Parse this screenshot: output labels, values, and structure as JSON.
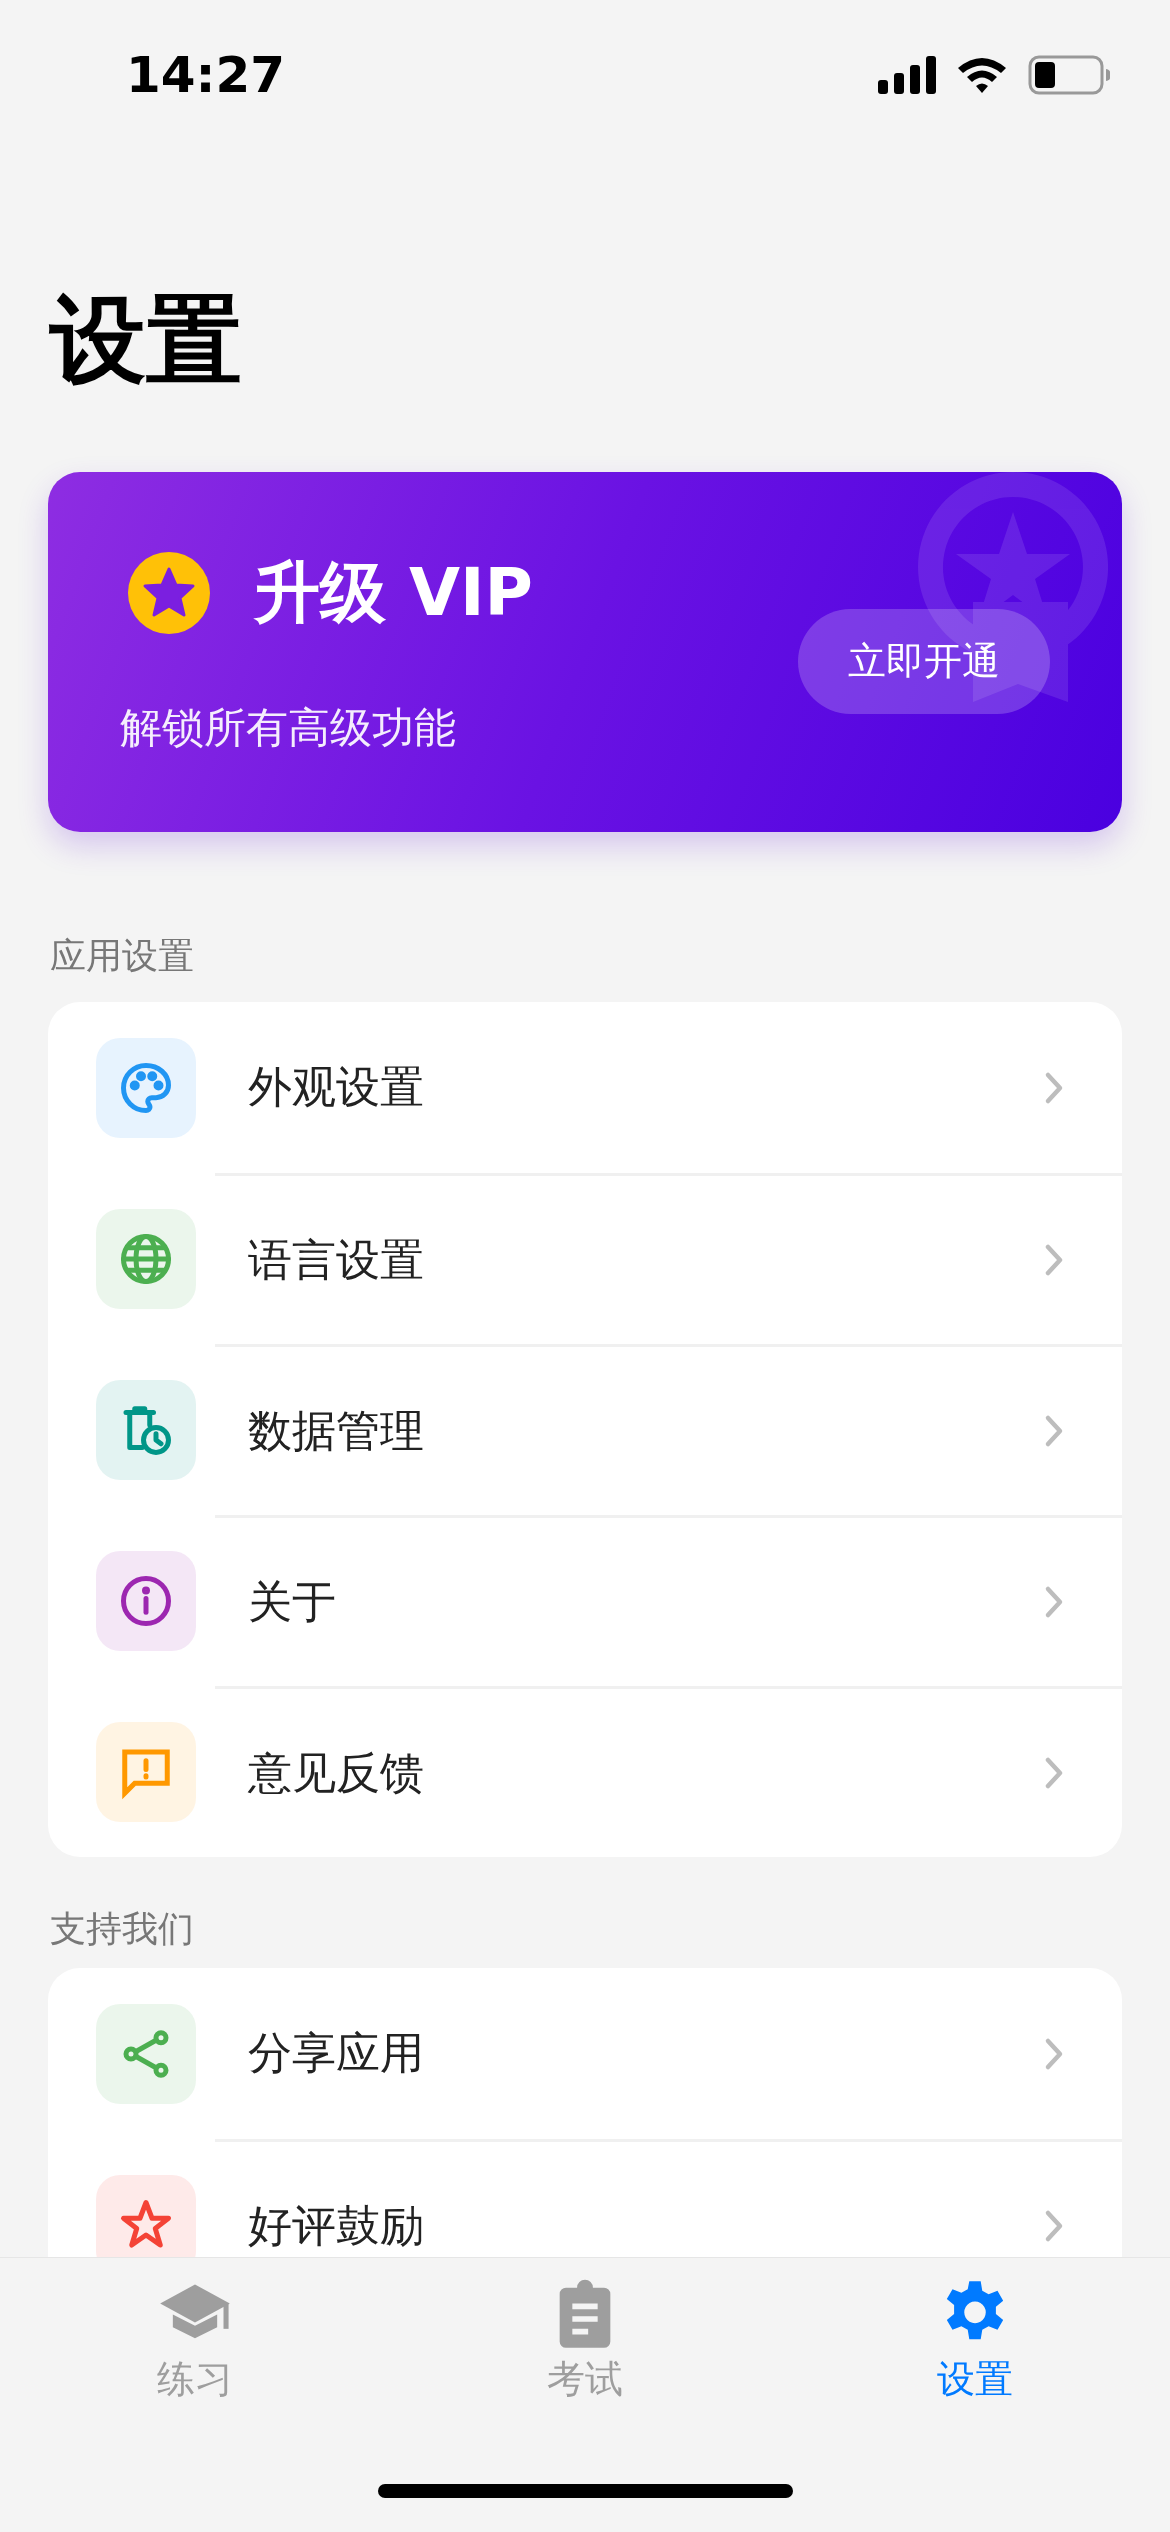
{
  "status_bar": {
    "time": "14:27"
  },
  "title": "设置",
  "vip_card": {
    "title": "升级 VIP",
    "subtitle": "解锁所有高级功能",
    "button": "立即开通"
  },
  "sections": [
    {
      "header": "应用设置",
      "items": [
        {
          "label": "外观设置",
          "kind": "palette",
          "color": "#2196f3"
        },
        {
          "label": "语言设置",
          "kind": "globe",
          "color": "#4caf50"
        },
        {
          "label": "数据管理",
          "kind": "data",
          "color": "#009688"
        },
        {
          "label": "关于",
          "kind": "info",
          "color": "#9c27b0"
        },
        {
          "label": "意见反馈",
          "kind": "feedback",
          "color": "#ff9800"
        }
      ]
    },
    {
      "header": "支持我们",
      "items": [
        {
          "label": "分享应用",
          "kind": "share",
          "color": "#4caf50"
        },
        {
          "label": "好评鼓励",
          "kind": "star",
          "color": "#f44336"
        }
      ]
    }
  ],
  "tab_bar": [
    {
      "label": "练习",
      "kind": "school",
      "selected": false
    },
    {
      "label": "考试",
      "kind": "exam",
      "selected": false
    },
    {
      "label": "设置",
      "kind": "gear",
      "selected": true
    }
  ]
}
